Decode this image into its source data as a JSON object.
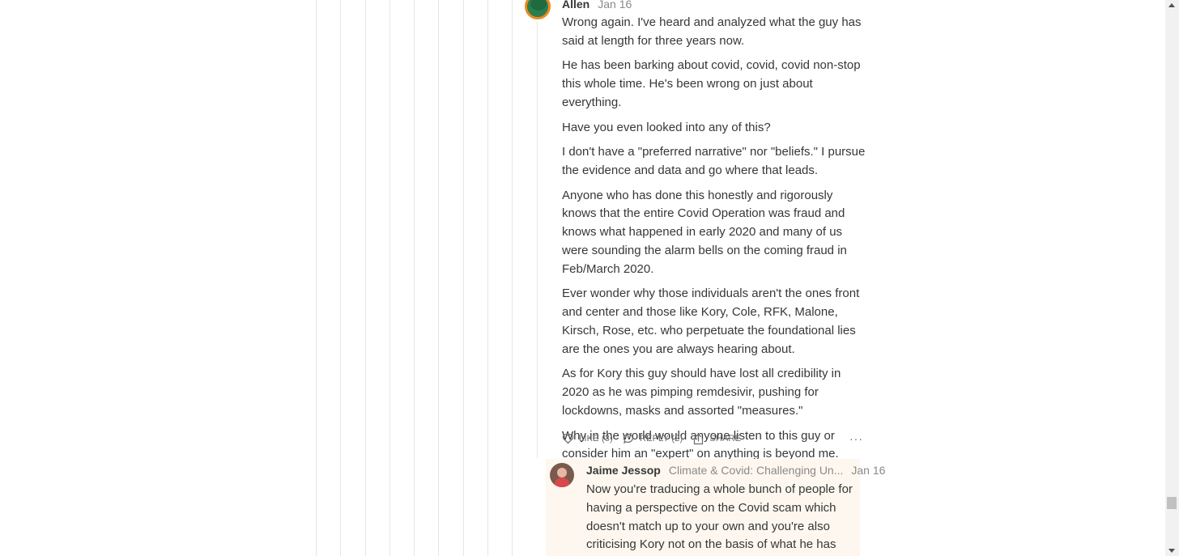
{
  "comment": {
    "author": "Allen",
    "date": "Jan 16",
    "paragraphs": [
      "Wrong again. I've heard and analyzed what the guy has said at length for three years now.",
      "He has been barking about covid, covid, covid non-stop this whole time. He's been wrong on just about everything.",
      "Have you even looked into any of this?",
      "I don't have a \"preferred narrative\" nor \"beliefs.\" I pursue the evidence and data and go where that leads.",
      "Anyone who has done this honestly and rigorously knows that the entire Covid Operation was fraud and knows what happened in early 2020 and many of us were sounding the alarm bells on the coming fraud in Feb/March 2020.",
      "Ever wonder why those individuals aren't the ones front and center and those like Kory, Cole, RFK, Malone, Kirsch, Rose, etc. who perpetuate the foundational lies are the ones you are always hearing about.",
      "As for Kory this guy should have lost all credibility in 2020 as he was pimping remdesivir, pushing for lockdowns, masks and assorted \"measures.\"",
      "Why in the world would anyone listen to this guy or consider him an \"expert\" on anything is beyond me."
    ],
    "actions": {
      "like": "LIKE (3)",
      "reply": "REPLY (2)",
      "share": "SHARE",
      "more": "···"
    }
  },
  "reply": {
    "author": "Jaime Jessop",
    "publication": "Climate & Covid: Challenging Un...",
    "date": "Jan 16",
    "text": "Now you're traducing a whole bunch of people for having a perspective on the Covid scam which doesn't match up to your own and you're also criticising Kory not on the basis of what he has written specifically,"
  },
  "colors": {
    "text": "#363737",
    "meta": "#8a8a8a",
    "reply_background": "#fdf7ef",
    "thread_line": "#e6e6e6"
  },
  "icons": {
    "like": "heart-icon",
    "reply": "speech-bubble-icon",
    "share": "share-icon",
    "more": "ellipsis-icon"
  }
}
